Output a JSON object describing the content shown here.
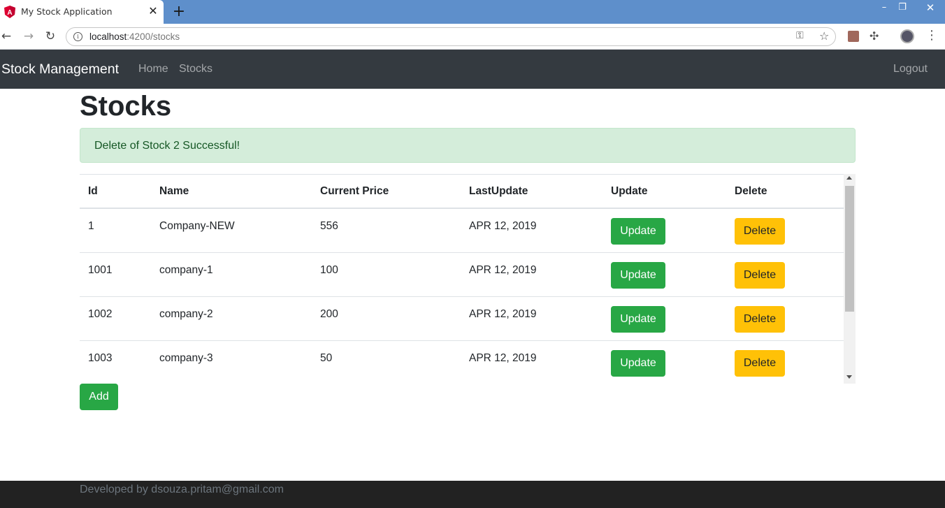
{
  "browser": {
    "tab_title": "My Stock Application",
    "tab_close_glyph": "✕",
    "new_tab_glyph": "+",
    "url_host": "localhost",
    "url_path": ":4200/stocks",
    "window_min": "–",
    "window_max": "❐",
    "window_close": "✕",
    "back_glyph": "←",
    "forward_glyph": "→",
    "reload_glyph": "↻",
    "star_glyph": "☆",
    "key_glyph": "⚿",
    "puzzle_glyph": "✣",
    "menu_glyph": "⋮",
    "info_glyph": "i"
  },
  "navbar": {
    "brand": "Stock Management",
    "home": "Home",
    "stocks": "Stocks",
    "logout": "Logout"
  },
  "page": {
    "title": "Stocks",
    "alert": "Delete of Stock 2 Successful!"
  },
  "table": {
    "headers": [
      "Id",
      "Name",
      "Current Price",
      "LastUpdate",
      "Update",
      "Delete"
    ],
    "rows": [
      {
        "id": "1",
        "name": "Company-NEW",
        "price": "556",
        "last_update": "APR 12, 2019",
        "update_label": "Update",
        "delete_label": "Delete"
      },
      {
        "id": "1001",
        "name": "company-1",
        "price": "100",
        "last_update": "APR 12, 2019",
        "update_label": "Update",
        "delete_label": "Delete"
      },
      {
        "id": "1002",
        "name": "company-2",
        "price": "200",
        "last_update": "APR 12, 2019",
        "update_label": "Update",
        "delete_label": "Delete"
      },
      {
        "id": "1003",
        "name": "company-3",
        "price": "50",
        "last_update": "APR 12, 2019",
        "update_label": "Update",
        "delete_label": "Delete"
      }
    ]
  },
  "actions": {
    "add_label": "Add"
  },
  "footer": {
    "text": "Developed by dsouza.pritam@gmail.com"
  },
  "colors": {
    "tabstrip": "#5e8fcb",
    "navbar": "#343a40",
    "success": "#28a745",
    "warning": "#ffc107",
    "alert_bg": "#d4edda",
    "alert_text": "#155724",
    "footer": "#222222"
  }
}
